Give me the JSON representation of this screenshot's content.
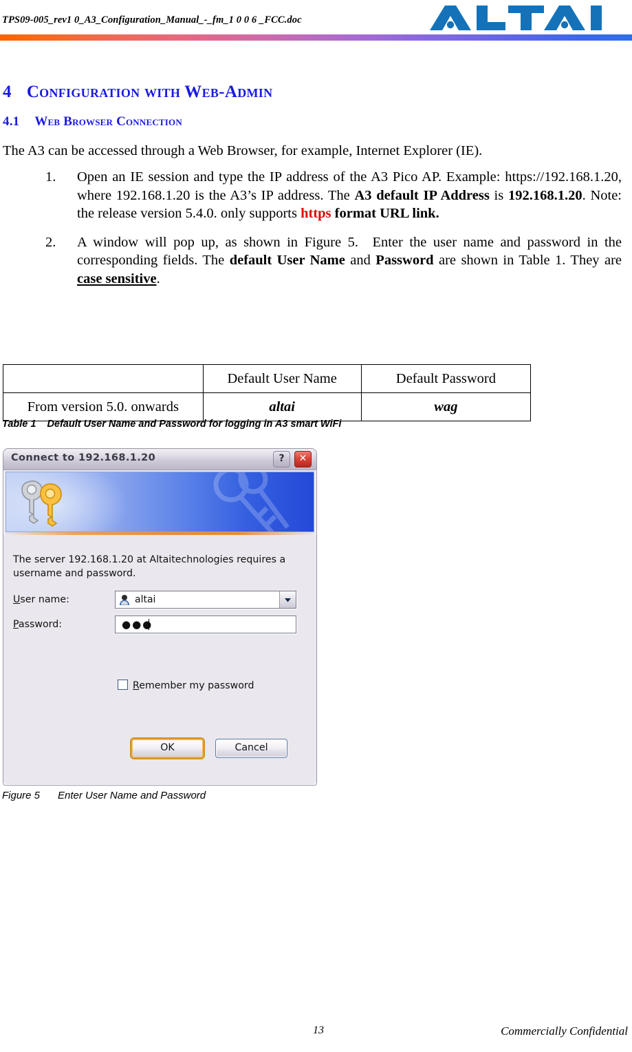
{
  "header": {
    "document_name": "TPS09-005_rev1 0_A3_Configuration_Manual_-_fm_1 0 0 6 _FCC.doc",
    "logo_text": "ALTAI",
    "logo_color": "#1572b8",
    "rule_gradient_from": "#fa6400",
    "rule_gradient_to": "#2f6fe8"
  },
  "section": {
    "number": "4",
    "title": "Configuration with Web-Admin",
    "heading_color": "#1a1ae0"
  },
  "subsection": {
    "number": "4.1",
    "title": "Web Browser Connection"
  },
  "intro_paragraph": "The A3 can be accessed through a Web Browser, for example, Internet Explorer (IE).",
  "steps": [
    {
      "marker": "1.",
      "segments": [
        {
          "text": "Open an IE session and type the IP address of the A3 Pico AP. Example: https://192.168.1.20, where 192.168.1.20 is the A3’s IP address. The ",
          "style": "normal"
        },
        {
          "text": "A3 default IP Address",
          "style": "bold"
        },
        {
          "text": " is ",
          "style": "normal"
        },
        {
          "text": "192.168.1.20",
          "style": "bold"
        },
        {
          "text": ". Note: the release version 5.4.0. only supports ",
          "style": "normal"
        },
        {
          "text": "https",
          "style": "red-bold"
        },
        {
          "text": " format URL link.",
          "style": "bold"
        }
      ]
    },
    {
      "marker": "2.",
      "segments": [
        {
          "text": "A window will pop up, as shown in Figure 5. Enter the user name and password in the corresponding fields. The ",
          "style": "normal"
        },
        {
          "text": "default User Name",
          "style": "bold"
        },
        {
          "text": " and ",
          "style": "normal"
        },
        {
          "text": "Password",
          "style": "bold"
        },
        {
          "text": " are shown in Table 1. They are ",
          "style": "normal"
        },
        {
          "text": "case sensitive",
          "style": "bold-underline"
        },
        {
          "text": ".",
          "style": "normal"
        }
      ]
    }
  ],
  "table": {
    "headers": [
      "",
      "Default User Name",
      "Default Password"
    ],
    "rows": [
      {
        "label": "From version 5.0. onwards",
        "user_name": "altai",
        "password": "wag"
      }
    ],
    "caption_label": "Table 1",
    "caption_text": "Default User Name and Password for logging in A3 smart WiFi"
  },
  "dialog": {
    "title": "Connect to 192.168.1.20",
    "help_button": "?",
    "close_button": "✕",
    "message": "The server 192.168.1.20 at Altaitechnologies requires a username and password.",
    "username_label": "User name:",
    "username_value": "altai",
    "password_label": "Password:",
    "password_value": "●●●",
    "remember_checkbox_label": "Remember my password",
    "remember_checked": false,
    "ok_button": "OK",
    "cancel_button": "Cancel"
  },
  "figure": {
    "caption_label": "Figure 5",
    "caption_text": "Enter User Name and Password"
  },
  "footer": {
    "page_number": "13",
    "confidentiality": "Commercially Confidential"
  }
}
